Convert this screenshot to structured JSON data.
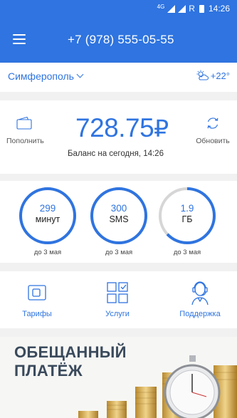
{
  "status_bar": {
    "network": "4G",
    "roaming": "R",
    "time": "14:26"
  },
  "header": {
    "phone": "+7 (978) 555-05-55"
  },
  "location": {
    "city": "Симферополь",
    "weather": "+22°"
  },
  "balance": {
    "topup_label": "Пополнить",
    "amount": "728.75",
    "currency": "₽",
    "refresh_label": "Обновить",
    "date_label": "Баланс на сегодня, 14:26"
  },
  "usage": [
    {
      "value": "299",
      "unit": "минут",
      "until": "до 3 мая",
      "fill_fraction": 1.0
    },
    {
      "value": "300",
      "unit": "SMS",
      "until": "до 3 мая",
      "fill_fraction": 1.0
    },
    {
      "value": "1.9",
      "unit": "ГБ",
      "until": "до 3 мая",
      "fill_fraction": 0.63
    }
  ],
  "quick_actions": [
    {
      "label": "Тарифы",
      "icon": "sim-card-icon"
    },
    {
      "label": "Услуги",
      "icon": "services-grid-icon"
    },
    {
      "label": "Поддержка",
      "icon": "support-agent-icon"
    }
  ],
  "promo": {
    "title_line1": "ОБЕЩАННЫЙ",
    "title_line2": "ПЛАТЁЖ"
  },
  "colors": {
    "accent": "#2f74e0",
    "ring_track": "#d6d6d6",
    "background": "#f1f1f1"
  }
}
